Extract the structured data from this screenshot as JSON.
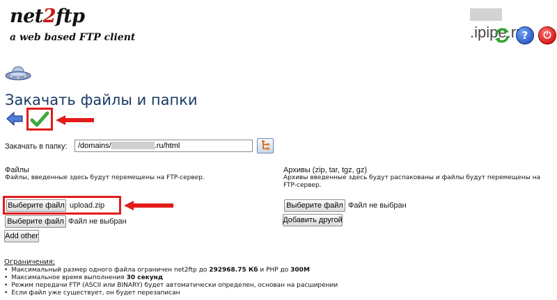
{
  "logo": {
    "main_a": "net",
    "main_b": "2",
    "main_c": "ftp",
    "tagline": "a web based FTP client"
  },
  "host": {
    "suffix": ".ipipe.ru"
  },
  "toolbar": {
    "refresh_icon": "refresh-icon",
    "help_icon": "help-icon",
    "help_glyph": "?",
    "power_icon": "power-icon",
    "power_glyph": "⏻"
  },
  "page_title": "Закачать файлы и папки",
  "upload_dir": {
    "label": "Закачать в папку:",
    "value_prefix": "/domains/",
    "value_suffix": ".ru/html"
  },
  "files": {
    "heading": "Файлы",
    "description": "Файлы, введенные здесь будут перемещены на FTP-сервер.",
    "inputs": [
      {
        "button": "Выберите файл",
        "value": "upload.zip"
      },
      {
        "button": "Выберите файл",
        "value": "Файл не выбран"
      }
    ],
    "add_button": "Add other"
  },
  "archives": {
    "heading": "Архивы (zip, tar, tgz, gz)",
    "description_1": "Архивы введенные здесь будут распакованы и файлы будут перемещены на",
    "description_2": "FTP-сервер.",
    "input": {
      "button": "Выберите файл",
      "value": "Файл не выбран"
    },
    "add_button": "Добавить другой"
  },
  "limits": {
    "title": "Ограничения:",
    "items": [
      {
        "a": "Максимальный размер одного файла ограничен net2ftp до ",
        "b": "292968.75 Кб",
        "c": " и PHP до ",
        "d": "300M"
      },
      {
        "a": "Максимальное время выполнения ",
        "b": "30 секунд"
      },
      {
        "a": "Режим передачи FTP (ASCII или BINARY) будет автоматически определен, основан на расширении"
      },
      {
        "a": "Если файл уже существует, он будет перезаписан"
      }
    ]
  },
  "colors": {
    "accent_red": "#e31b1b",
    "title_blue": "#183a63",
    "logo_red": "#c21a17"
  }
}
